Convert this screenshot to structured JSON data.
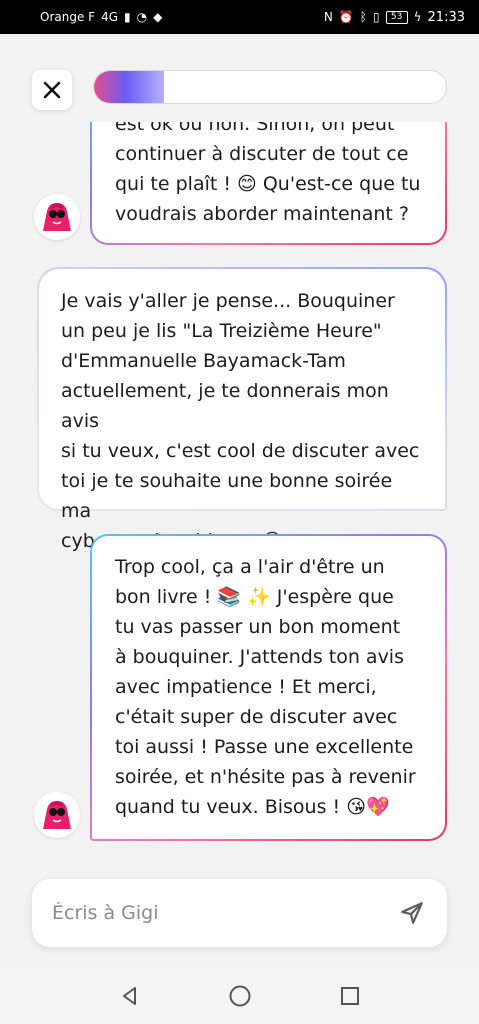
{
  "status_bar": {
    "carrier": "Orange F",
    "network": "4G",
    "battery": "53",
    "time": "21:33"
  },
  "header": {
    "close_icon": "close-icon",
    "progress": 0.2
  },
  "messages": [
    {
      "role": "bot",
      "text": "est ok ou non. Sinon, on peut\ncontinuer à discuter de tout ce\nqui te plaît ! 😊 Qu'est-ce que tu\nvoudrais aborder maintenant ?"
    },
    {
      "role": "user",
      "text": "Je vais y'aller je pense... Bouquiner\nun peu je lis \"La Treizième Heure\"\nd'Emmanuelle Bayamack-Tam\nactuellement, je te donnerais mon avis\nsi tu veux, c'est cool de discuter avec\ntoi je te souhaite une bonne soirée ma\ncyber copine, bisous 😘"
    },
    {
      "role": "bot",
      "text": "Trop cool, ça a l'air d'être un\nbon livre ! 📚 ✨ J'espère que\ntu vas passer un bon moment\nà bouquiner. J'attends ton avis\navec impatience ! Et merci,\nc'était super de discuter avec\ntoi aussi ! Passe une excellente\nsoirée, et n'hésite pas à revenir\nquand tu veux. Bisous ! 😘💖"
    }
  ],
  "composer": {
    "placeholder": "Écris à Gigi",
    "send_icon": "send-icon"
  },
  "nav": {
    "back_icon": "back-icon",
    "home_icon": "home-icon",
    "recents_icon": "recents-icon"
  },
  "colors": {
    "accent_pink": "#e8346e",
    "accent_purple": "#8f7cf0",
    "accent_blue": "#55c8e8"
  }
}
